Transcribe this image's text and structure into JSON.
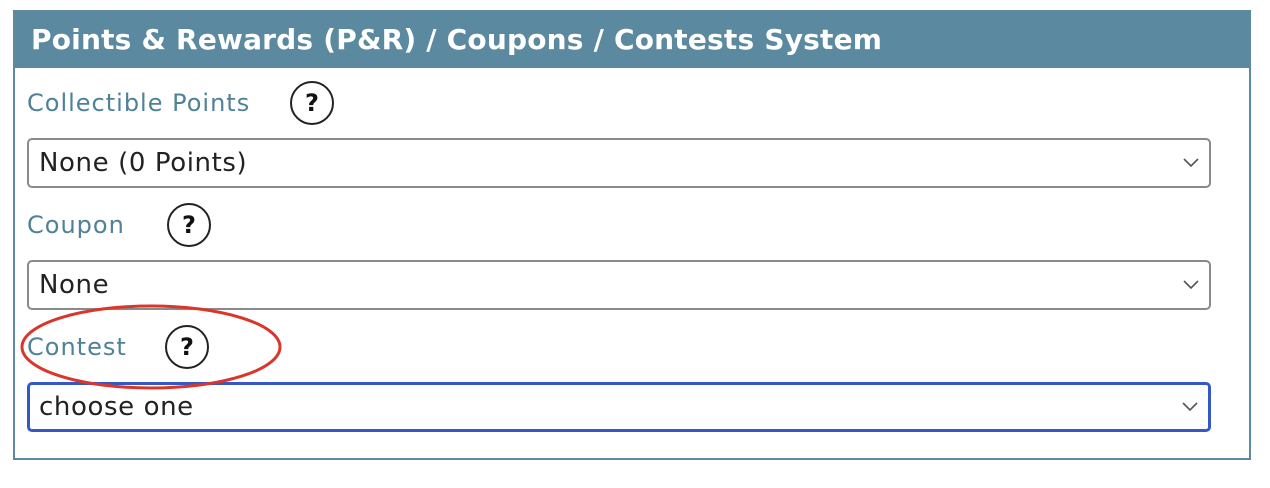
{
  "panel": {
    "title": "Points & Rewards (P&R) / Coupons / Contests System"
  },
  "fields": [
    {
      "label": "Collectible Points",
      "help_symbol": "?",
      "value": "None (0 Points)"
    },
    {
      "label": "Coupon",
      "help_symbol": "?",
      "value": "None"
    },
    {
      "label": "Contest",
      "help_symbol": "?",
      "value": "choose one"
    }
  ],
  "icons": {
    "help": "question-circle-icon",
    "dropdown": "chevron-down-icon"
  },
  "colors": {
    "header_bg": "#5b8aa0",
    "label_text": "#4f8197",
    "focus_border": "#3558c9",
    "annotation": "#d9372b"
  }
}
